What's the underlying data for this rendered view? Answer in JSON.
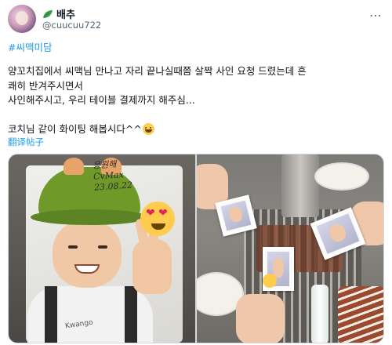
{
  "header": {
    "display_name": "배추",
    "handle": "@cuucuu722",
    "more_label": "⋯"
  },
  "tweet": {
    "hashtag": "#씨맥미담",
    "lines": [
      "양꼬치집에서 씨맥님 만나고 자리 끝나실때쯤 살짝 사인 요청 드렸는데 흔",
      "쾌히 반겨주시면서",
      "사인해주시고, 우리 테이블 결제까지 해주심...",
      "",
      "코치님 같이 화이팅 해봅시다^^"
    ],
    "translate_label": "翻译帖子"
  },
  "media": {
    "left_photo": {
      "signature_lines": [
        "응원해",
        "CvMax",
        "23.08.22"
      ],
      "shirt_text": "Kwango"
    },
    "right_photo": {}
  },
  "colors": {
    "link": "#1d9bf0",
    "secondary_text": "#536471",
    "primary_text": "#0f1419"
  }
}
